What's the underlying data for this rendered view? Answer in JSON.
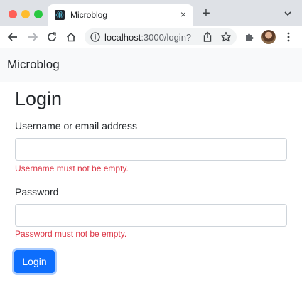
{
  "browser": {
    "tab_title": "Microblog",
    "new_tab_symbol": "+",
    "close_symbol": "×",
    "url_host": "localhost",
    "url_rest": ":3000/login?"
  },
  "navbar": {
    "brand": "Microblog"
  },
  "page": {
    "title": "Login",
    "username": {
      "label": "Username or email address",
      "value": "",
      "error": "Username must not be empty."
    },
    "password": {
      "label": "Password",
      "value": "",
      "error": "Password must not be empty."
    },
    "submit_label": "Login"
  },
  "colors": {
    "primary": "#0d6efd",
    "error": "#dc3545",
    "navbar_bg": "#f8f9fa"
  },
  "icons": [
    "react-favicon-icon",
    "close-icon",
    "plus-icon",
    "chevron-down-icon",
    "back-arrow-icon",
    "forward-arrow-icon",
    "reload-icon",
    "home-icon",
    "info-icon",
    "share-icon",
    "star-icon",
    "extensions-puzzle-icon",
    "kebab-menu-icon"
  ]
}
